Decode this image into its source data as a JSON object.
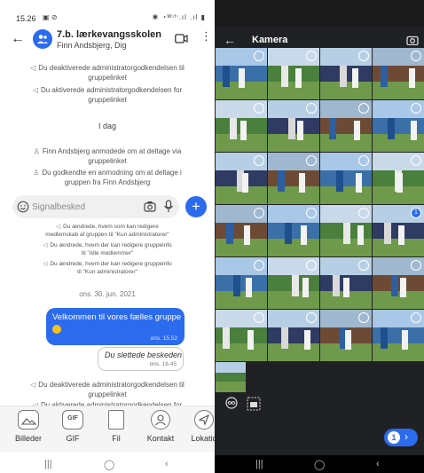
{
  "left": {
    "status": {
      "time": "15.26",
      "left_icons": "▣ ⊘",
      "right_icons": "✱ ◔ᵂᶦᶠᶦ.ıl .ıl ▮"
    },
    "header": {
      "title": "7.b. lærkevangsskolen",
      "subtitle": "Finn Andsbjerg, Dig"
    },
    "system_messages_top": [
      {
        "icon": "megaphone-icon",
        "text_lines": [
          "Du deaktiverede administratorgodkendelsen til",
          "gruppelinket"
        ]
      },
      {
        "icon": "megaphone-icon",
        "text_lines": [
          "Du aktiverede administratorgodkendelsen for",
          "gruppelinket"
        ]
      }
    ],
    "day_label": "I dag",
    "system_messages_today": [
      {
        "icon": "person-add-icon",
        "text_lines": [
          "Finn Andsbjerg anmodede om at deltage via",
          "gruppelinket"
        ]
      },
      {
        "icon": "person-approve-icon",
        "text_lines": [
          "Du godkendte en anmodning om at deltage i",
          "gruppen fra Finn Andsbjerg"
        ]
      }
    ],
    "composer": {
      "placeholder": "Signalbesked"
    },
    "system_messages_small": [
      {
        "text_lines": [
          "Du ændrede, hvem som kan redigere",
          "medlemskab af gruppen til \"Kun administratorer\""
        ]
      },
      {
        "text_lines": [
          "Du ændrede, hvem der kan redigere gruppeinfo",
          "til \"Alle medlemmer\""
        ]
      },
      {
        "text_lines": [
          "Du ændrede, hvem der kan redigere gruppeinfo",
          "til \"Kun administratorer\""
        ]
      }
    ],
    "date_divider": "ons. 30. jun. 2021",
    "outgoing": {
      "text": "Velkommen til vores fælles gruppe",
      "time": "ons. 15.52"
    },
    "deleted": {
      "text": "Du slettede beskeden",
      "time": "ons. 16.45"
    },
    "system_messages_bottom": [
      {
        "text_lines": [
          "Du deaktiverede administratorgodkendelsen til",
          "gruppelinket"
        ]
      },
      {
        "text_lines": [
          "Du aktiverede administratorgodkendelsen for"
        ]
      }
    ],
    "attach": [
      {
        "label": "Billeder",
        "icon": "image-icon"
      },
      {
        "label": "GIF",
        "icon": "gif-icon"
      },
      {
        "label": "Fil",
        "icon": "file-icon"
      },
      {
        "label": "Kontakt",
        "icon": "contact-icon"
      },
      {
        "label": "Lokatio",
        "icon": "location-icon"
      }
    ],
    "nav": {
      "recents": "|||",
      "home": "◯",
      "back": "‹"
    }
  },
  "right": {
    "title": "Kamera",
    "selected_count": "1",
    "nav": {
      "recents": "|||",
      "home": "◯",
      "back": "‹"
    }
  }
}
